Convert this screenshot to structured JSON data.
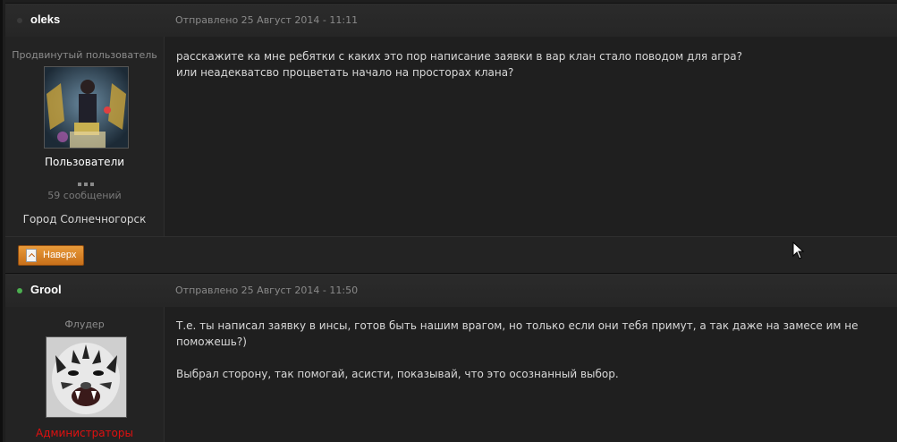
{
  "posts": [
    {
      "author": "oleks",
      "online": false,
      "posted": "Отправлено 25 Август 2014 - 11:11",
      "rank": "Продвинутый пользователь",
      "group": "Пользователи",
      "group_color": "#ffffff",
      "post_count": "59 сообщений",
      "city": "Город Солнечногорск",
      "avatar_icon": "game-character-avatar",
      "content": [
        "расскажите ка мне ребятки с каких это пор написание заявки в вар клан стало поводом для агра?",
        "или неадекватсво процветать начало на просторах клана?"
      ]
    },
    {
      "author": "Grool",
      "online": true,
      "posted": "Отправлено 25 Август 2014 - 11:50",
      "rank": "Флудер",
      "group": "Администраторы",
      "group_color": "#e01010",
      "avatar_icon": "tiger-avatar",
      "content": [
        "Т.е. ты написал заявку в инсы, готов быть нашим врагом, но только если они тебя примут, а так даже на замесе им не поможешь?)",
        "Выбрал сторону, так помогай, асисти, показывай, что это осознанный выбор."
      ]
    }
  ],
  "top_button": {
    "label": "Наверх",
    "icon": "page-up-icon"
  },
  "colors": {
    "online": "#4caf50",
    "offline": "#3a3a3a",
    "button": "#d9822b"
  }
}
